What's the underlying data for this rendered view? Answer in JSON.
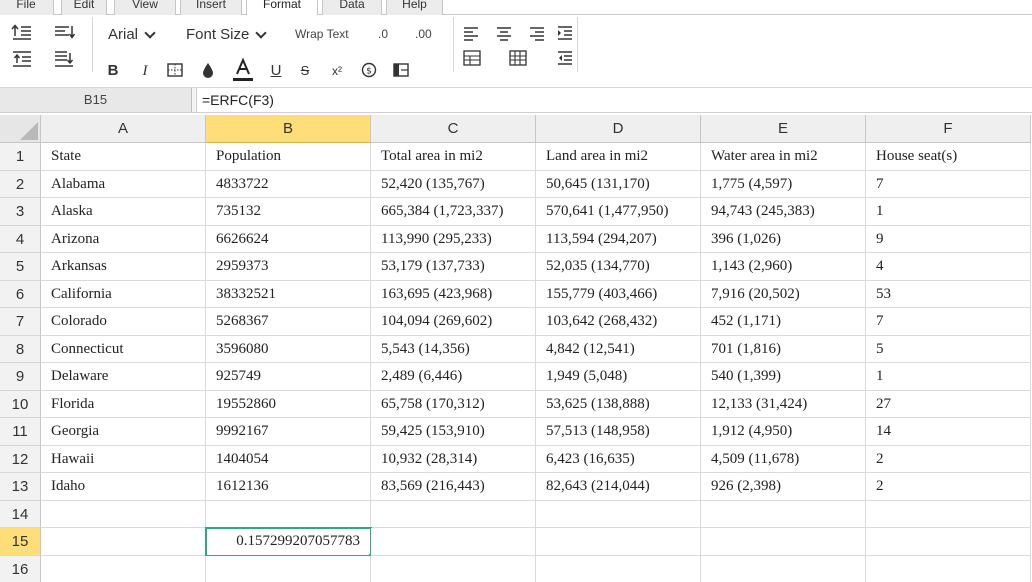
{
  "menu": {
    "tabs": [
      {
        "label": "File"
      },
      {
        "label": "Edit"
      },
      {
        "label": "View"
      },
      {
        "label": "Insert"
      },
      {
        "label": "Format"
      },
      {
        "label": "Data"
      },
      {
        "label": "Help"
      }
    ],
    "active_tab": "Format"
  },
  "toolbar": {
    "font_name": "Arial",
    "font_size_label": "Font Size",
    "wrap_text_label": "Wrap Text",
    "decrease_decimal_label": ".0",
    "increase_decimal_label": ".00",
    "bold_label": "B",
    "italic_label": "I",
    "underline_label": "U",
    "strike_label": "S",
    "superscript_label": "x²",
    "accent_color": "#2aa887",
    "selected_header_color": "#ffde7a"
  },
  "formula_bar": {
    "cell_ref": "B15",
    "formula": "=ERFC(F3)"
  },
  "sheet": {
    "columns": [
      "A",
      "B",
      "C",
      "D",
      "E",
      "F"
    ],
    "selected_column": "B",
    "selected_row": "15",
    "rows": [
      {
        "num": "1",
        "cells": [
          "State",
          "Population",
          "Total area in mi2",
          "Land area in mi2",
          "Water area in mi2",
          "House seat(s)"
        ]
      },
      {
        "num": "2",
        "cells": [
          "Alabama",
          "4833722",
          "52,420 (135,767)",
          "50,645 (131,170)",
          "1,775 (4,597)",
          "7"
        ]
      },
      {
        "num": "3",
        "cells": [
          "Alaska",
          "735132",
          "665,384 (1,723,337)",
          "570,641 (1,477,950)",
          "94,743 (245,383)",
          "1"
        ]
      },
      {
        "num": "4",
        "cells": [
          "Arizona",
          "6626624",
          "113,990 (295,233)",
          "113,594 (294,207)",
          "396 (1,026)",
          "9"
        ]
      },
      {
        "num": "5",
        "cells": [
          "Arkansas",
          "2959373",
          "53,179 (137,733)",
          "52,035 (134,770)",
          "1,143 (2,960)",
          "4"
        ]
      },
      {
        "num": "6",
        "cells": [
          "California",
          "38332521",
          "163,695 (423,968)",
          "155,779 (403,466)",
          "7,916 (20,502)",
          "53"
        ]
      },
      {
        "num": "7",
        "cells": [
          "Colorado",
          "5268367",
          "104,094 (269,602)",
          "103,642 (268,432)",
          "452 (1,171)",
          "7"
        ]
      },
      {
        "num": "8",
        "cells": [
          "Connecticut",
          "3596080",
          "5,543 (14,356)",
          "4,842 (12,541)",
          "701 (1,816)",
          "5"
        ]
      },
      {
        "num": "9",
        "cells": [
          "Delaware",
          "925749",
          "2,489 (6,446)",
          "1,949 (5,048)",
          "540 (1,399)",
          "1"
        ]
      },
      {
        "num": "10",
        "cells": [
          "Florida",
          "19552860",
          "65,758 (170,312)",
          "53,625 (138,888)",
          "12,133 (31,424)",
          "27"
        ]
      },
      {
        "num": "11",
        "cells": [
          "Georgia",
          "9992167",
          "59,425 (153,910)",
          "57,513 (148,958)",
          "1,912 (4,950)",
          "14"
        ]
      },
      {
        "num": "12",
        "cells": [
          "Hawaii",
          "1404054",
          "10,932 (28,314)",
          "6,423 (16,635)",
          "4,509 (11,678)",
          "2"
        ]
      },
      {
        "num": "13",
        "cells": [
          "Idaho",
          "1612136",
          "83,569 (216,443)",
          "82,643 (214,044)",
          "926 (2,398)",
          "2"
        ]
      },
      {
        "num": "14",
        "cells": [
          "",
          "",
          "",
          "",
          "",
          ""
        ]
      },
      {
        "num": "15",
        "cells": [
          "",
          "0.157299207057783",
          "",
          "",
          "",
          ""
        ]
      },
      {
        "num": "16",
        "cells": [
          "",
          "",
          "",
          "",
          "",
          ""
        ]
      }
    ]
  }
}
